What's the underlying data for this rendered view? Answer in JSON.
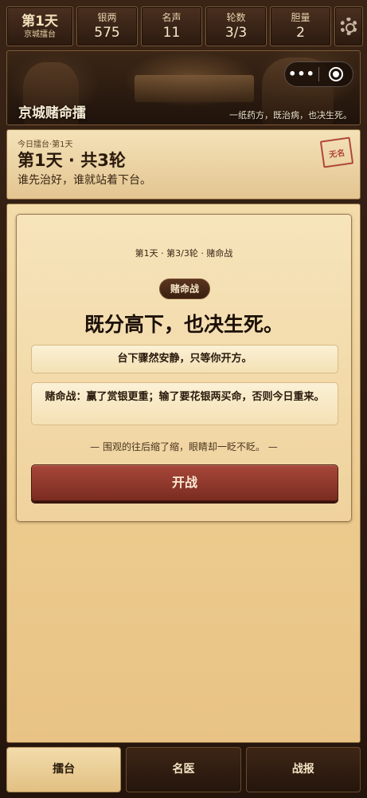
{
  "stats": {
    "day": "第1天",
    "location": "京城擂台",
    "silver_label": "银两",
    "silver_value": "575",
    "fame_label": "名声",
    "fame_value": "11",
    "rounds_label": "轮数",
    "rounds_value": "3/3",
    "courage_label": "胆量",
    "courage_value": "2",
    "settings_icon": "gear-icon"
  },
  "banner": {
    "title": "京城赌命擂",
    "subtitle": "一纸药方，既治病，也决生死。",
    "more_glyph": "•••"
  },
  "day_panel": {
    "kicker": "今日擂台·第1天",
    "heading": "第1天 · 共3轮",
    "motto": "谁先治好，谁就站着下台。",
    "seal": "无名"
  },
  "battle_card": {
    "round_info": "第1天 · 第3/3轮 · 赌命战",
    "tag": "赌命战",
    "headline": "既分高下，也决生死。",
    "note1": "台下骤然安静，只等你开方。",
    "note2": "赌命战：赢了赏银更重；输了要花银两买命，否则今日重来。",
    "crowd": "— 围观的往后缩了缩，眼睛却一眨不眨。 —",
    "action_label": "开战"
  },
  "tabs": [
    "擂台",
    "名医",
    "战报"
  ],
  "colors": {
    "accent_red": "#a7473a",
    "parchment": "#f3dcaa",
    "dark_wood": "#2c1a10",
    "seal_red": "#b0473a"
  }
}
